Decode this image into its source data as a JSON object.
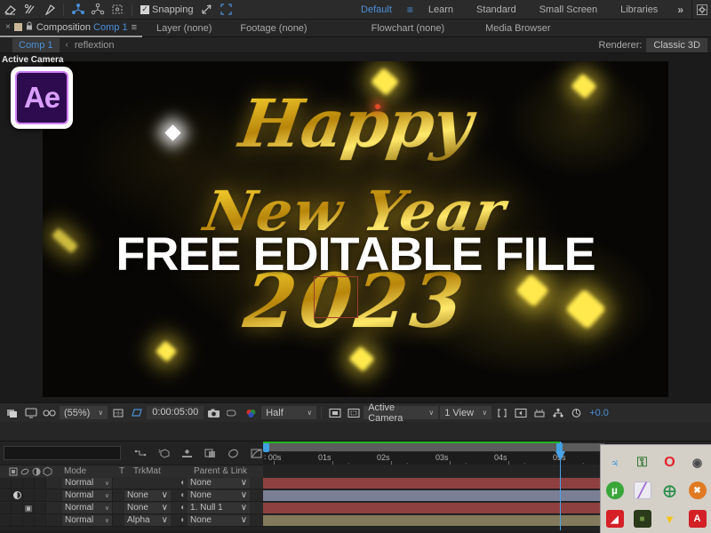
{
  "toolbar": {
    "tools": [
      {
        "name": "eraser-tool"
      },
      {
        "name": "roto-brush-tool"
      },
      {
        "name": "puppet-pin-tool"
      },
      {
        "name": "puppet-starch-tool"
      },
      {
        "name": "puppet-overlap-tool"
      },
      {
        "name": "puppet-bend-tool"
      }
    ],
    "snapping_label": "Snapping",
    "snapping_checked": true,
    "workspaces": [
      {
        "label": "Default",
        "active": true
      },
      {
        "label": "Learn",
        "active": false
      },
      {
        "label": "Standard",
        "active": false
      },
      {
        "label": "Small Screen",
        "active": false
      },
      {
        "label": "Libraries",
        "active": false
      }
    ],
    "more_label": "»"
  },
  "panel_tabs": {
    "composition": {
      "close": "×",
      "prefix": "Composition",
      "name": "Comp 1",
      "menu": "≡"
    },
    "layer": "Layer  (none)",
    "footage": "Footage  (none)",
    "flowchart": "Flowchart  (none)",
    "media_browser": "Media Browser"
  },
  "breadcrumb": {
    "comp": "Comp 1",
    "arrow": "‹",
    "text": "reflextion",
    "renderer_label": "Renderer:",
    "renderer_value": "Classic 3D"
  },
  "viewport": {
    "active_camera_label": "Active Camera",
    "badge_text": "Ae",
    "overlay_text": "FREE EDITABLE FILE",
    "artwork": {
      "line1": "Happy",
      "line2": "New Year",
      "line3": "2023"
    }
  },
  "comp_bar": {
    "zoom": "(55%)",
    "timecode": "0:00:05:00",
    "resolution": "Half",
    "view_camera": "Active Camera",
    "view_count": "1 View",
    "exposure": "+0.0",
    "caret": "∨"
  },
  "timeline": {
    "ruler_labels": [
      "∶ 00s",
      "01s",
      "02s",
      "03s",
      "04s",
      "05s"
    ],
    "columns": {
      "mode": "Mode",
      "t": "T",
      "trkmat": "TrkMat",
      "parent": "Parent & Link"
    },
    "rows": [
      {
        "mode": "Normal",
        "trkmat": "",
        "parent": "None",
        "bar_color": "#8e4040",
        "has_trkmat": false
      },
      {
        "mode": "Normal",
        "trkmat": "None",
        "parent": "None",
        "bar_color": "#7b7f96",
        "has_trkmat": true
      },
      {
        "mode": "Normal",
        "trkmat": "None",
        "parent": "1. Null 1",
        "bar_color": "#8e4040",
        "has_trkmat": true
      },
      {
        "mode": "Normal",
        "trkmat": "Alpha",
        "parent": "None",
        "bar_color": "#837a5e",
        "has_trkmat": true
      }
    ],
    "caret": "∨"
  },
  "tray": {
    "icons": [
      {
        "name": "bluetooth-icon",
        "glyph": "ᛗ",
        "color": "#0a7fe0",
        "bg": "transparent",
        "selected": false
      },
      {
        "name": "shield-icon",
        "glyph": "⛨",
        "color": "#3a7a3a",
        "bg": "transparent",
        "selected": false
      },
      {
        "name": "opera-icon",
        "glyph": "O",
        "color": "#e8202a",
        "bg": "transparent",
        "selected": false
      },
      {
        "name": "dark-eye-icon",
        "glyph": "◉",
        "color": "#555555",
        "bg": "transparent",
        "selected": false
      },
      {
        "name": "utorrent-icon",
        "glyph": "µ",
        "color": "#ffffff",
        "bg": "#3aa63a",
        "selected": false
      },
      {
        "name": "pen-tool-icon",
        "glyph": "╱",
        "color": "#9b6ad1",
        "bg": "#eceaf2",
        "selected": true
      },
      {
        "name": "globe-download-icon",
        "glyph": "⊕",
        "color": "#2d8f4e",
        "bg": "transparent",
        "selected": false
      },
      {
        "name": "warning-disabled-icon",
        "glyph": "✖",
        "color": "#ffffff",
        "bg": "#e07a22",
        "selected": false
      },
      {
        "name": "adobe-red-icon",
        "glyph": "◢",
        "color": "#ffffff",
        "bg": "#d62027",
        "selected": false
      },
      {
        "name": "camo-lock-icon",
        "glyph": "■",
        "color": "#6f8f3f",
        "bg": "#2a3a1a",
        "selected": false
      },
      {
        "name": "winrar-icon",
        "glyph": "▼",
        "color": "#f5c518",
        "bg": "transparent",
        "selected": false
      },
      {
        "name": "acrobat-icon",
        "glyph": "A",
        "color": "#ffffff",
        "bg": "#d32027",
        "selected": false
      }
    ]
  },
  "colors": {
    "accent_blue": "#4a90d9",
    "panel_bg": "#2b2b2b",
    "gold": "#f0c419"
  }
}
